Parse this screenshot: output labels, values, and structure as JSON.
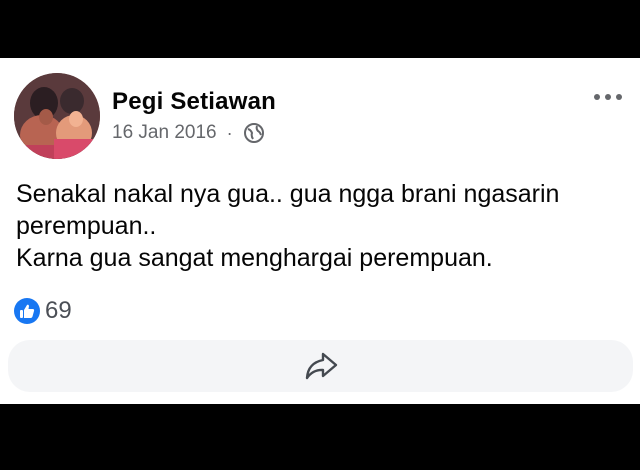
{
  "post": {
    "author_name": "Pegi Setiawan",
    "date": "16 Jan 2016",
    "separator": "·",
    "privacy_icon": "globe-icon",
    "text_lines": [
      "Senakal nakal nya gua.. gua ngga brani ngasarin",
      "perempuan..",
      "Karna gua sangat menghargai perempuan."
    ],
    "reactions": {
      "icon": "like-icon",
      "count": "69"
    },
    "actions": {
      "share_icon": "share-icon"
    }
  },
  "colors": {
    "background": "#000000",
    "card": "#ffffff",
    "like_blue": "#1877f2",
    "secondary_text": "#65676b",
    "action_bar": "#f4f5f7"
  }
}
